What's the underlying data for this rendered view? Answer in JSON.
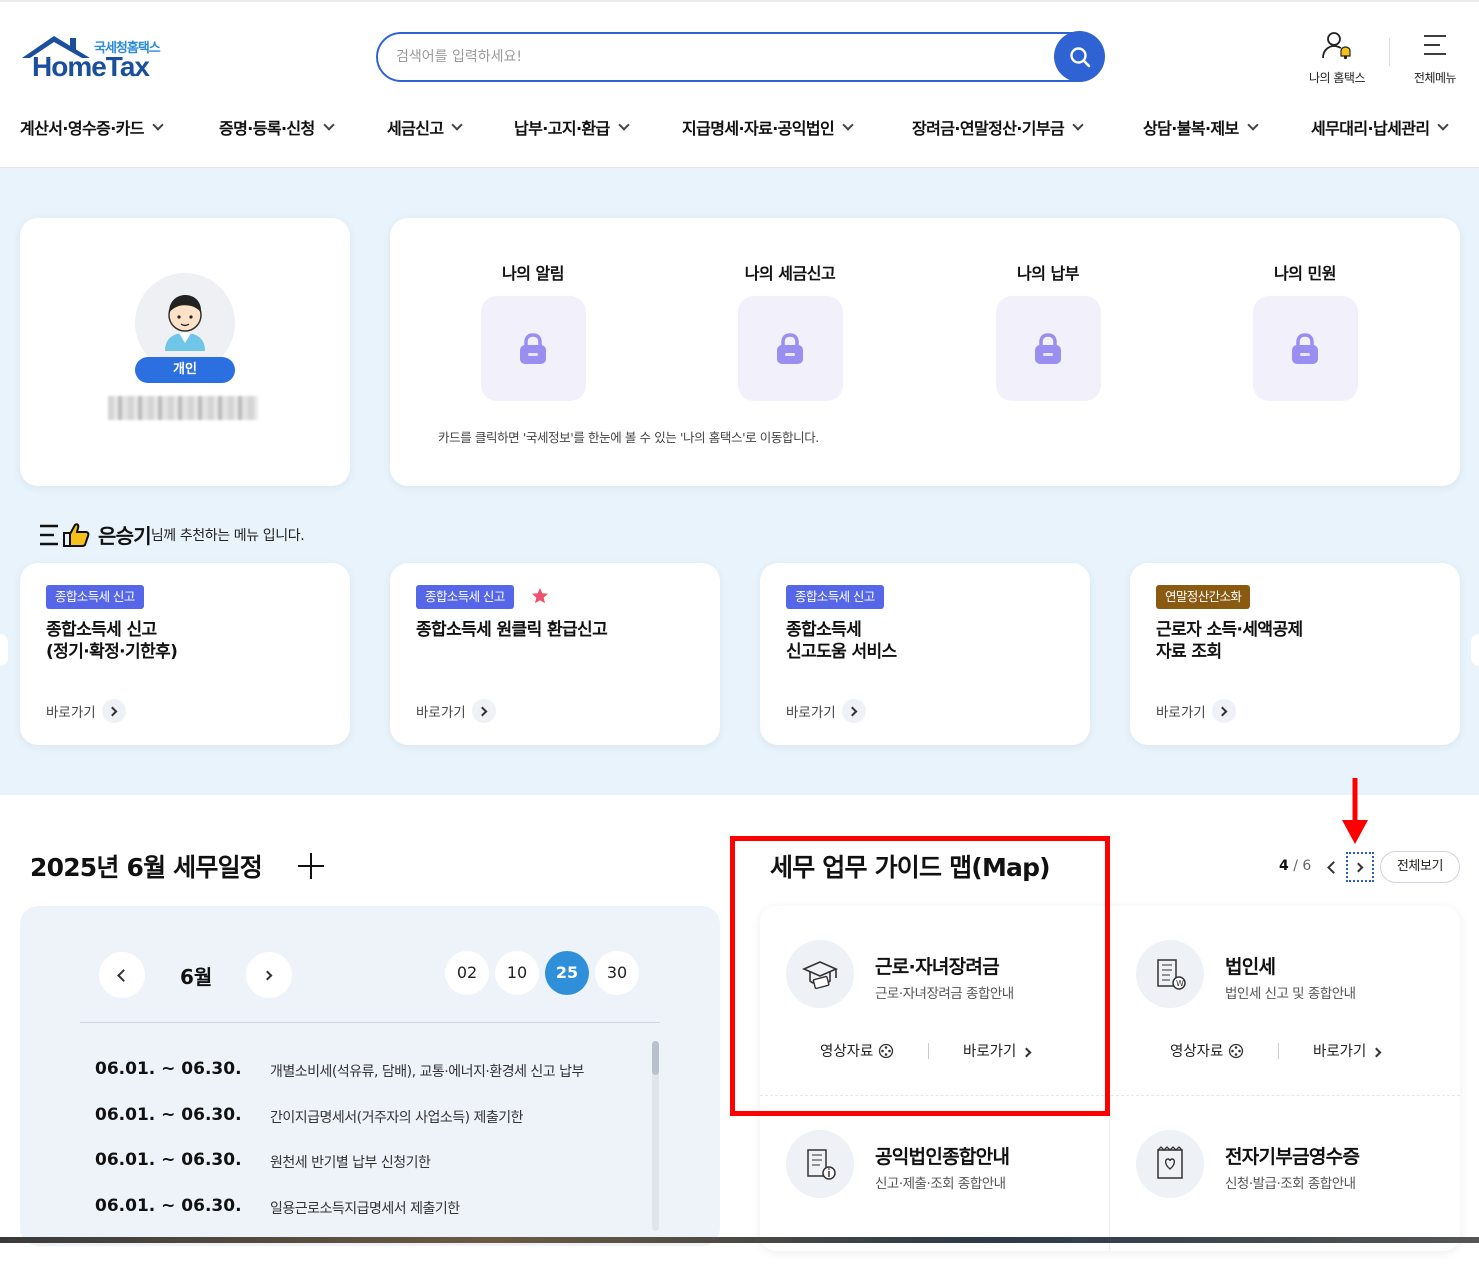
{
  "header": {
    "logo_sub": "국세청홈택스",
    "logo_main": "HomeTax",
    "search_placeholder": "검색어를 입력하세요!",
    "my_hometax": "나의 홈택스",
    "all_menu": "전체메뉴"
  },
  "gnb": [
    {
      "label": "계산서·영수증·카드"
    },
    {
      "label": "증명·등록·신청"
    },
    {
      "label": "세금신고"
    },
    {
      "label": "납부·고지·환급"
    },
    {
      "label": "지급명세·자료·공익법인"
    },
    {
      "label": "장려금·연말정산·기부금"
    },
    {
      "label": "상담·불복·제보"
    },
    {
      "label": "세무대리·납세관리"
    }
  ],
  "profile": {
    "kind": "개인"
  },
  "my_area": {
    "items": [
      {
        "label": "나의 알림"
      },
      {
        "label": "나의 세금신고"
      },
      {
        "label": "나의 납부"
      },
      {
        "label": "나의 민원"
      }
    ],
    "note": "카드를 클릭하면 '국세정보'를 한눈에 볼 수 있는 '나의 홈택스'로 이동합니다."
  },
  "recommend": {
    "user": "은승기",
    "suffix": "님께 추천하는 메뉴 입니다.",
    "cards": [
      {
        "tag": "종합소득세 신고",
        "line1": "종합소득세 신고",
        "line2": "(정기·확정·기한후)",
        "go": "바로가기"
      },
      {
        "tag": "종합소득세 신고",
        "line1": "종합소득세 원클릭 환급신고",
        "line2": "",
        "go": "바로가기"
      },
      {
        "tag": "종합소득세 신고",
        "line1": "종합소득세",
        "line2": "신고도움 서비스",
        "go": "바로가기"
      },
      {
        "tag": "연말정산간소화",
        "line1": "근로자 소득·세액공제",
        "line2": "자료 조회",
        "go": "바로가기"
      }
    ]
  },
  "schedule": {
    "title": "2025년 6월 세무일정",
    "month": "6월",
    "days": [
      "02",
      "10",
      "25",
      "30"
    ],
    "selected_day": "25",
    "items": [
      {
        "date": "06.01. ~ 06.30.",
        "text": "개별소비세(석유류, 담배), 교통·에너지·환경세 신고 납부"
      },
      {
        "date": "06.01. ~ 06.30.",
        "text": "간이지급명세서(거주자의 사업소득) 제출기한"
      },
      {
        "date": "06.01. ~ 06.30.",
        "text": "원천세 반기별 납부 신청기한"
      },
      {
        "date": "06.01. ~ 06.30.",
        "text": "일용근로소득지급명세서 제출기한"
      }
    ]
  },
  "guide": {
    "title": "세무 업무 가이드 맵(Map)",
    "page_current": "4",
    "page_total": "/ 6",
    "view_all": "전체보기",
    "video_label": "영상자료",
    "go_label": "바로가기",
    "items": [
      {
        "name": "근로·자녀장려금",
        "desc": "근로·자녀장려금 종합안내",
        "icon": "graduation-cap-icon"
      },
      {
        "name": "법인세",
        "desc": "법인세 신고 및 종합안내",
        "icon": "building-won-icon"
      },
      {
        "name": "공익법인종합안내",
        "desc": "신고·제출·조회 종합안내",
        "icon": "building-info-icon"
      },
      {
        "name": "전자기부금영수증",
        "desc": "신청·발급·조회 종합안내",
        "icon": "donation-receipt-icon"
      }
    ]
  },
  "colors": {
    "brand_blue": "#2f63d3",
    "hero_bg": "#e8f3fb",
    "tag_blue": "#5666e8",
    "tag_brown": "#8a5a12",
    "day_selected": "#2f8fd8",
    "annotation_red": "#ff0000"
  }
}
